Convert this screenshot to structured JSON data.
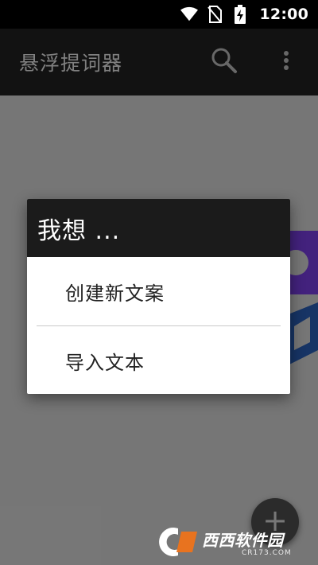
{
  "status_bar": {
    "time": "12:00",
    "icons": [
      "wifi-icon",
      "no-sim-icon",
      "battery-charging-icon"
    ]
  },
  "app_bar": {
    "title": "悬浮提词器",
    "actions": [
      "search-icon",
      "more-vert-icon"
    ]
  },
  "dialog": {
    "title": "我想 ...",
    "options": [
      {
        "label": "创建新文案"
      },
      {
        "label": "导入文本"
      }
    ]
  },
  "fab": {
    "icon": "plus-icon"
  },
  "watermark": {
    "logo_text": "西西软件园",
    "site": "CR173.COM"
  },
  "colors": {
    "app_bar": "#212121",
    "dialog_header": "#1b1b1b",
    "accent_logo": "#7b3fe4",
    "accent_blue": "#2a5fb8"
  }
}
